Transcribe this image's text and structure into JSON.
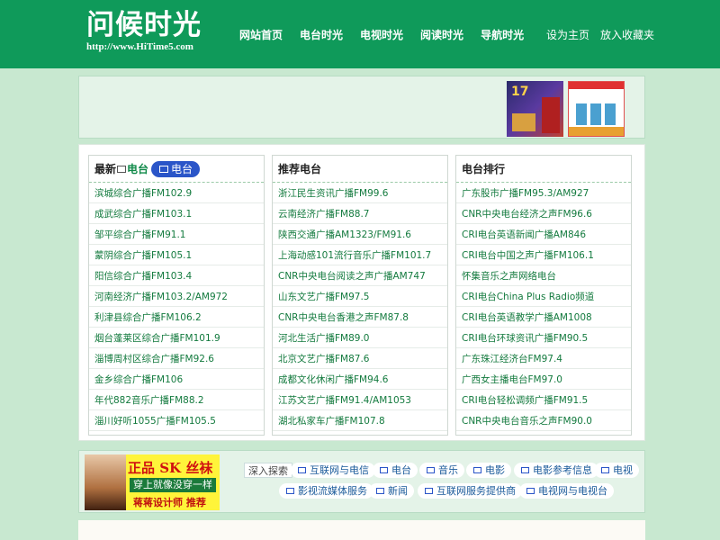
{
  "header": {
    "logo_title": "问候时光",
    "logo_url": "http://www.HiTime5.com",
    "nav": [
      "网站首页",
      "电台时光",
      "电视时光",
      "阅读时光",
      "导航时光"
    ],
    "right_links": [
      "设为主页",
      "放入收藏夹"
    ],
    "bg_color": "#0f9a5a"
  },
  "ads": {
    "ad1_text": "17",
    "ad3_big": "正品 SK 丝袜",
    "ad3_mid": "穿上就像没穿一样",
    "ad3_small": "蒋蒋设计师 推荐"
  },
  "columns": [
    {
      "title_prefix": "最新",
      "title_green": "电台",
      "pill": "电台",
      "items": [
        "滨城综合广播FM102.9",
        "成武综合广播FM103.1",
        "邹平综合广播FM91.1",
        "蒙阴综合广播FM105.1",
        "阳信综合广播FM103.4",
        "河南经济广播FM103.2/AM972",
        "利津县综合广播FM106.2",
        "烟台蓬莱区综合广播FM101.9",
        "淄博周村区综合广播FM92.6",
        "金乡综合广播FM106",
        "年代882音乐广播FM88.2",
        "淄川好听1055广播FM105.5"
      ]
    },
    {
      "title": "推荐电台",
      "items": [
        "浙江民生资讯广播FM99.6",
        "云南经济广播FM88.7",
        "陕西交通广播AM1323/FM91.6",
        "上海动感101流行音乐广播FM101.7",
        "CNR中央电台阅读之声广播AM747",
        "山东文艺广播FM97.5",
        "CNR中央电台香港之声FM87.8",
        "河北生活广播FM89.0",
        "北京文艺广播FM87.6",
        "成都文化休闲广播FM94.6",
        "江苏文艺广播FM91.4/AM1053",
        "湖北私家车广播FM107.8"
      ]
    },
    {
      "title": "电台排行",
      "items": [
        "广东股市广播FM95.3/AM927",
        "CNR中央电台经济之声FM96.6",
        "CRI电台英语新闻广播AM846",
        "CRI电台中国之声广播FM106.1",
        "怀集音乐之声网络电台",
        "CRI电台China Plus Radio频道",
        "CRI电台英语教学广播AM1008",
        "CRI电台环球资讯广播FM90.5",
        "广东珠江经济台FM97.4",
        "广西女主播电台FM97.0",
        "CRI电台轻松调频广播FM91.5",
        "CNR中央电台音乐之声FM90.0"
      ]
    }
  ],
  "tags": {
    "label": "深入探索",
    "row1": [
      "互联网与电信",
      "电台",
      "音乐",
      "电影",
      "电影参考信息",
      "电视"
    ],
    "row2": [
      "影视流媒体服务",
      "新闻",
      "互联网服务提供商",
      "电视网与电视台"
    ]
  }
}
